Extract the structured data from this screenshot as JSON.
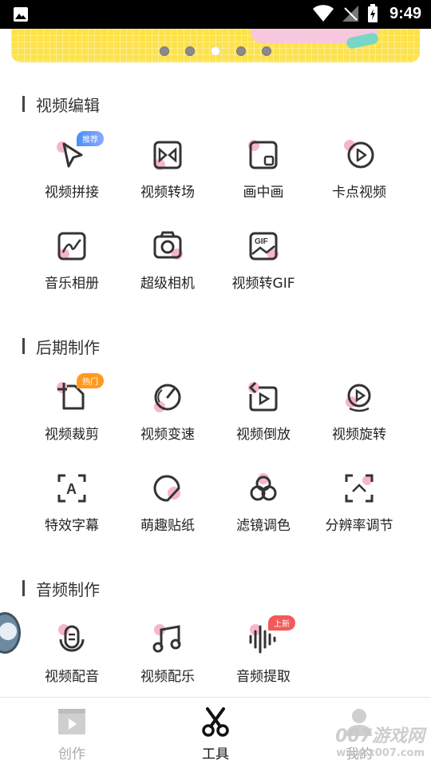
{
  "status_bar": {
    "time": "9:49"
  },
  "banner": {
    "pages": 5,
    "active_page": 3
  },
  "sections": [
    {
      "title": "视频编辑",
      "tools": [
        {
          "label": "视频拼接",
          "icon": "pointer-icon",
          "badge": "推荐",
          "badge_color": "#4a90f5"
        },
        {
          "label": "视频转场",
          "icon": "transition-icon"
        },
        {
          "label": "画中画",
          "icon": "picture-in-picture-icon"
        },
        {
          "label": "卡点视频",
          "icon": "play-circle-icon"
        },
        {
          "label": "音乐相册",
          "icon": "music-album-icon"
        },
        {
          "label": "超级相机",
          "icon": "camera-icon"
        },
        {
          "label": "视频转GIF",
          "icon": "gif-icon"
        }
      ]
    },
    {
      "title": "后期制作",
      "tools": [
        {
          "label": "视频裁剪",
          "icon": "crop-icon",
          "badge": "热门",
          "badge_color": "#ff9a1f"
        },
        {
          "label": "视频变速",
          "icon": "speedometer-icon"
        },
        {
          "label": "视频倒放",
          "icon": "reverse-play-icon"
        },
        {
          "label": "视频旋转",
          "icon": "rotate-icon"
        },
        {
          "label": "特效字幕",
          "icon": "subtitle-icon"
        },
        {
          "label": "萌趣贴纸",
          "icon": "sticker-icon"
        },
        {
          "label": "滤镜调色",
          "icon": "filter-icon"
        },
        {
          "label": "分辨率调节",
          "icon": "resolution-icon"
        }
      ]
    },
    {
      "title": "音频制作",
      "tools": [
        {
          "label": "视频配音",
          "icon": "microphone-icon"
        },
        {
          "label": "视频配乐",
          "icon": "music-note-icon"
        },
        {
          "label": "音频提取",
          "icon": "waveform-icon",
          "badge": "上新",
          "badge_color": "#f25a5a"
        }
      ]
    }
  ],
  "tabs": [
    {
      "label": "创作",
      "icon": "clapperboard-icon",
      "active": false
    },
    {
      "label": "工具",
      "icon": "scissors-icon",
      "active": true
    },
    {
      "label": "我的",
      "icon": "profile-icon",
      "active": false
    }
  ],
  "watermark": {
    "brand": "007游戏网",
    "url": "www.x007.com"
  },
  "colors": {
    "accent_pink": "#f7b6c8",
    "icon_stroke": "#333333",
    "tab_active": "#111111",
    "tab_inactive": "#aaaaaa"
  }
}
